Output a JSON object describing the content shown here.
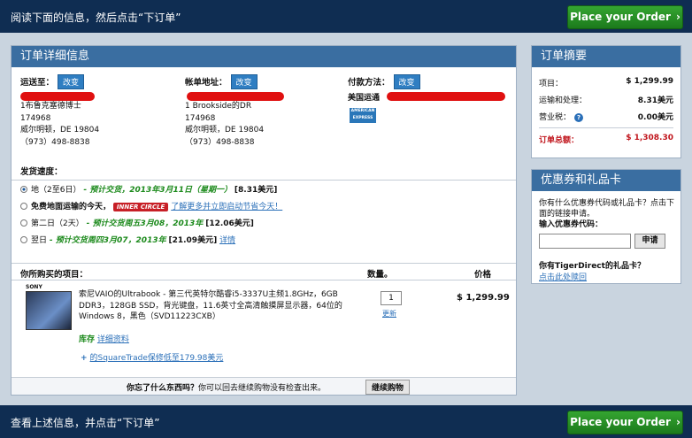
{
  "top_bar": {
    "instruction": "阅读下面的信息，然后点击“下订单”",
    "place_order_label": "Place your Order",
    "chevron": "›"
  },
  "bottom_bar": {
    "instruction": "查看上述信息，并点击“下订单”",
    "place_order_label": "Place your Order",
    "chevron": "›"
  },
  "order_details": {
    "title": "订单详细信息",
    "change_label": "改变",
    "shipping": {
      "heading": "运送至：",
      "lines": [
        "1布鲁克塞德博士",
        "174968",
        "威尔明顿，DE 19804",
        "（973）498-8838"
      ]
    },
    "billing": {
      "heading": "帐单地址：",
      "lines": [
        "1 Brookside的DR",
        "174968",
        "威尔明顿，DE 19804",
        "（973）498-8838"
      ]
    },
    "payment": {
      "heading": "付款方法：",
      "method": "美国运通",
      "card_logo_text": "AMERICAN EXPRESS"
    }
  },
  "shipping_speed": {
    "heading": "发货速度：",
    "options": [
      {
        "label": "地（2至6日）",
        "estimate": "- 预计交货，2013年3月11日（星期一）",
        "price": "[8.31美元]",
        "selected": true
      },
      {
        "label": "免费地面运输的今天，",
        "badge": "INNER CIRCLE",
        "link": "了解更多并立即启动节省今天！",
        "selected": false
      },
      {
        "label": "第二日（2天）",
        "estimate": "- 预计交货周五3月08，2013年",
        "price": "[12.06美元]",
        "selected": false
      },
      {
        "label": "翌日",
        "estimate": "- 预计交货周四3月07，2013年",
        "price": "[21.09美元]",
        "link": "详情",
        "selected": false
      }
    ]
  },
  "items": {
    "heading": "你所购买的项目：",
    "qty_heading": "数量。",
    "price_heading": "价格",
    "product": {
      "thumb_brand": "SONY",
      "description": "索尼VAIO的Ultrabook - 第三代英特尔酷睿i5-3337U主频1.8GHz，6GB DDR3，128GB SSD，背光键盘，11.6英寸全高清触摸屏显示器，64位的Windows 8，黑色（SVD11223CXB）",
      "qty": "1",
      "update_label": "更新",
      "price": "$ 1,299.99",
      "stock_label": "库存",
      "details_link": "详细资料",
      "warranty_link": "的SquareTrade保修低至179.98美元"
    },
    "forgot_text": "你忘了什么东西吗？你可以回去继续购物没有检查出来。",
    "forgot_bold": "你忘了什么东西吗？",
    "forgot_rest": "你可以回去继续购物没有检查出来。",
    "continue_label": "继续购物"
  },
  "summary": {
    "title": "订单摘要",
    "lines": [
      {
        "label": "项目：",
        "value": "$ 1,299.99"
      },
      {
        "label": "运输和处理：",
        "value": "8.31美元"
      },
      {
        "label": "营业税：",
        "value": "0.00美元"
      }
    ],
    "help_icon": "?",
    "total_label": "订单总额：",
    "total_value": "$ 1,308.30"
  },
  "coupon": {
    "title": "优惠券和礼品卡",
    "text": "你有什么优惠券代码或礼品卡？点击下面的链接申请。",
    "input_label": "输入优惠券代码：",
    "apply_label": "申请",
    "gift_question": "你有TigerDirect的礼品卡？",
    "gift_link": "点击此处赎回"
  },
  "colors": {
    "header_bar": "#0f2d52",
    "panel_title": "#3a6ea1",
    "place_order_green": "#2a9128",
    "total_red": "#c0141b",
    "estimate_green": "#1c8a1c"
  }
}
